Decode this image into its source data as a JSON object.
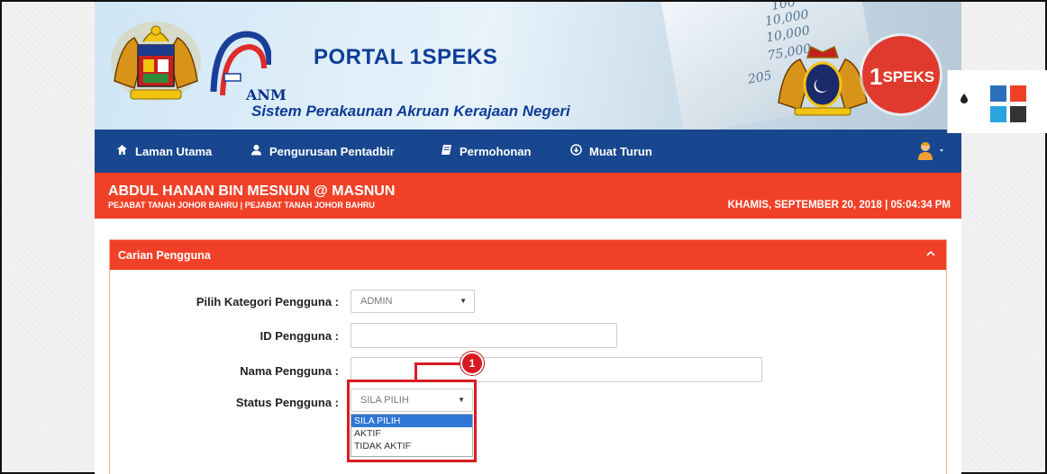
{
  "header": {
    "portal_title": "PORTAL 1SPEKS",
    "subtitle": "Sistem Perakaunan Akruan Kerajaan Negeri",
    "anm_label": "ANM",
    "brand_badge": "SPEKS",
    "brand_badge_prefix": "1",
    "banner_numbers": [
      "100",
      "10,000",
      "10,000",
      "75,000",
      "205"
    ]
  },
  "nav": {
    "items": [
      {
        "label": "Laman Utama",
        "icon": "home-icon"
      },
      {
        "label": "Pengurusan Pentadbir",
        "icon": "user-icon"
      },
      {
        "label": "Permohonan",
        "icon": "book-icon"
      },
      {
        "label": "Muat Turun",
        "icon": "download-icon"
      }
    ],
    "user_menu_icon": "user-avatar-icon"
  },
  "userbar": {
    "name": "ABDUL HANAN BIN MESNUN @ MASNUN",
    "office": "PEJABAT TANAH JOHOR BAHRU | PEJABAT TANAH JOHOR BAHRU",
    "datetime": "KHAMIS, SEPTEMBER 20, 2018 | 05:04:34 PM"
  },
  "panel": {
    "title": "Carian Pengguna",
    "toggle_icon": "chevron-up-icon",
    "fields": {
      "kategori_label": "Pilih Kategori Pengguna :",
      "kategori_value": "ADMIN",
      "id_label": "ID Pengguna :",
      "id_value": "",
      "nama_label": "Nama Pengguna :",
      "nama_value": "",
      "status_label": "Status Pengguna :",
      "status_value": "SILA PILIH"
    },
    "status_options": [
      "SILA PILIH",
      "AKTIF",
      "TIDAK AKTIF"
    ]
  },
  "annotation": {
    "number": "1",
    "color": "#d81b22"
  },
  "theme": {
    "icon": "drop-icon",
    "swatches": [
      "#2a6fb7",
      "#f04128",
      "#2aa3e0",
      "#333333"
    ]
  },
  "colors": {
    "nav": "#18478f",
    "accent": "#f04128",
    "select_highlight": "#2f77d6"
  }
}
